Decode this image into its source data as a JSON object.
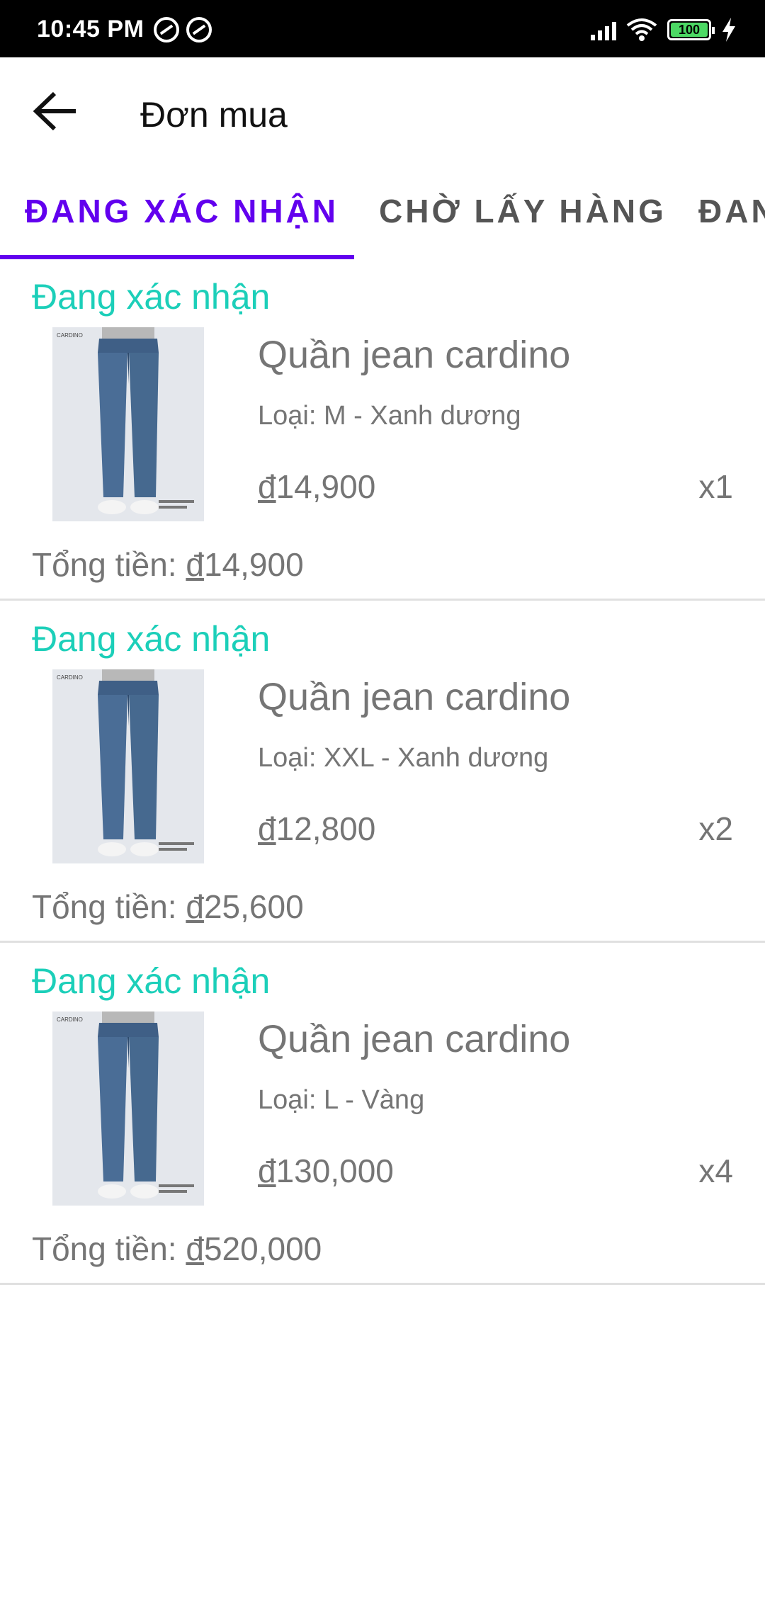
{
  "status_bar": {
    "time": "10:45 PM",
    "battery": "100"
  },
  "header": {
    "title": "Đơn mua"
  },
  "tabs": [
    {
      "label": "ĐANG XÁC NHẬN"
    },
    {
      "label": "CHỜ LẤY HÀNG"
    },
    {
      "label": "ĐAN"
    }
  ],
  "colors": {
    "accent": "#6200ee",
    "status": "#1ccfb9",
    "text": "#757575"
  },
  "orders": [
    {
      "status": "Đang xác nhận",
      "product_name": "Quần jean cardino",
      "variant": "Loại: M - Xanh dương",
      "currency": "đ",
      "price": "14,900",
      "quantity": "x1",
      "total_label": "Tổng tiền: ",
      "total": "14,900",
      "thumb_brand": "CARDINO"
    },
    {
      "status": "Đang xác nhận",
      "product_name": "Quần jean cardino",
      "variant": "Loại: XXL - Xanh dương",
      "currency": "đ",
      "price": "12,800",
      "quantity": "x2",
      "total_label": "Tổng tiền: ",
      "total": "25,600",
      "thumb_brand": "CARDINO"
    },
    {
      "status": "Đang xác nhận",
      "product_name": "Quần jean cardino",
      "variant": "Loại: L - Vàng",
      "currency": "đ",
      "price": "130,000",
      "quantity": "x4",
      "total_label": "Tổng tiền: ",
      "total": "520,000",
      "thumb_brand": "CARDINO"
    }
  ]
}
